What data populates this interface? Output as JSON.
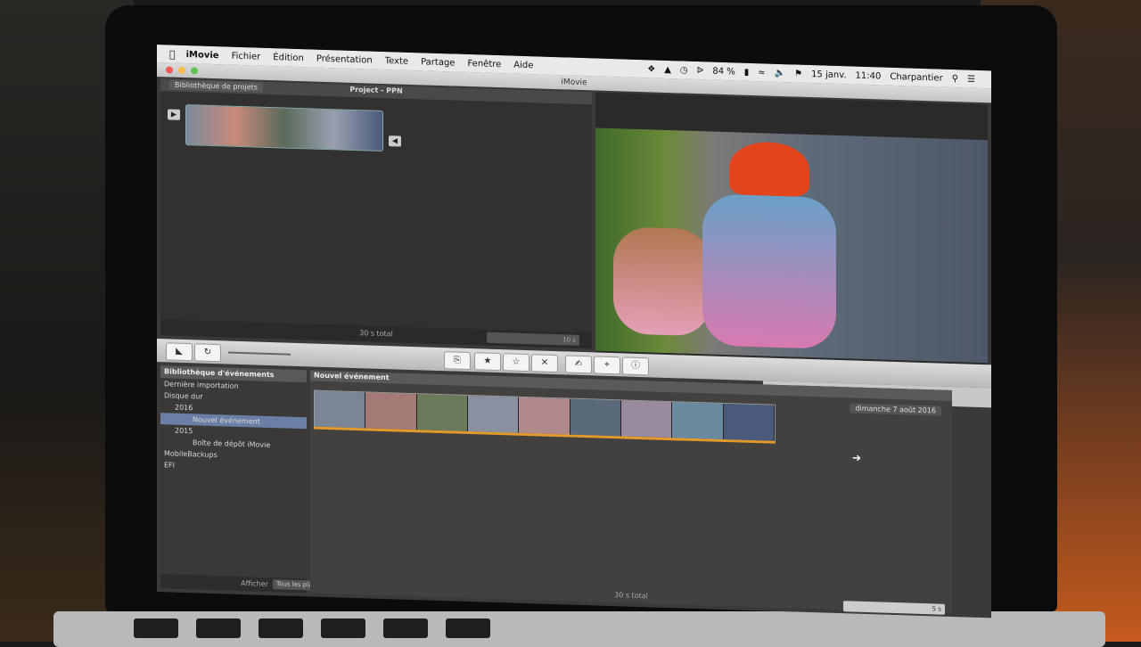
{
  "menubar": {
    "app": "iMovie",
    "items": [
      "Fichier",
      "Édition",
      "Présentation",
      "Texte",
      "Partage",
      "Fenêtre",
      "Aide"
    ],
    "battery": "84 %",
    "date": "15 janv.",
    "time": "11:40",
    "user": "Charpantier"
  },
  "window": {
    "title": "iMovie"
  },
  "project": {
    "library_tab": "Bibliothèque de projets",
    "name": "Project - PPN",
    "total": "30 s total",
    "zoom": "10 s"
  },
  "event_library": {
    "header": "Bibliothèque d'événements",
    "items": [
      {
        "label": "Dernière importation"
      },
      {
        "label": "Disque dur"
      },
      {
        "label": "2016"
      },
      {
        "label": "Nouvel événement"
      },
      {
        "label": "2015"
      },
      {
        "label": "Boîte de dépôt iMovie"
      },
      {
        "label": "MobileBackups"
      },
      {
        "label": "EFI"
      }
    ],
    "show_label": "Afficher",
    "show_value": "Tous les plans"
  },
  "events": {
    "header": "Nouvel événement",
    "date": "dimanche 7 août 2016",
    "total": "30 s total",
    "zoom": "5 s"
  },
  "branding": {
    "device": "MacBook Pro"
  }
}
